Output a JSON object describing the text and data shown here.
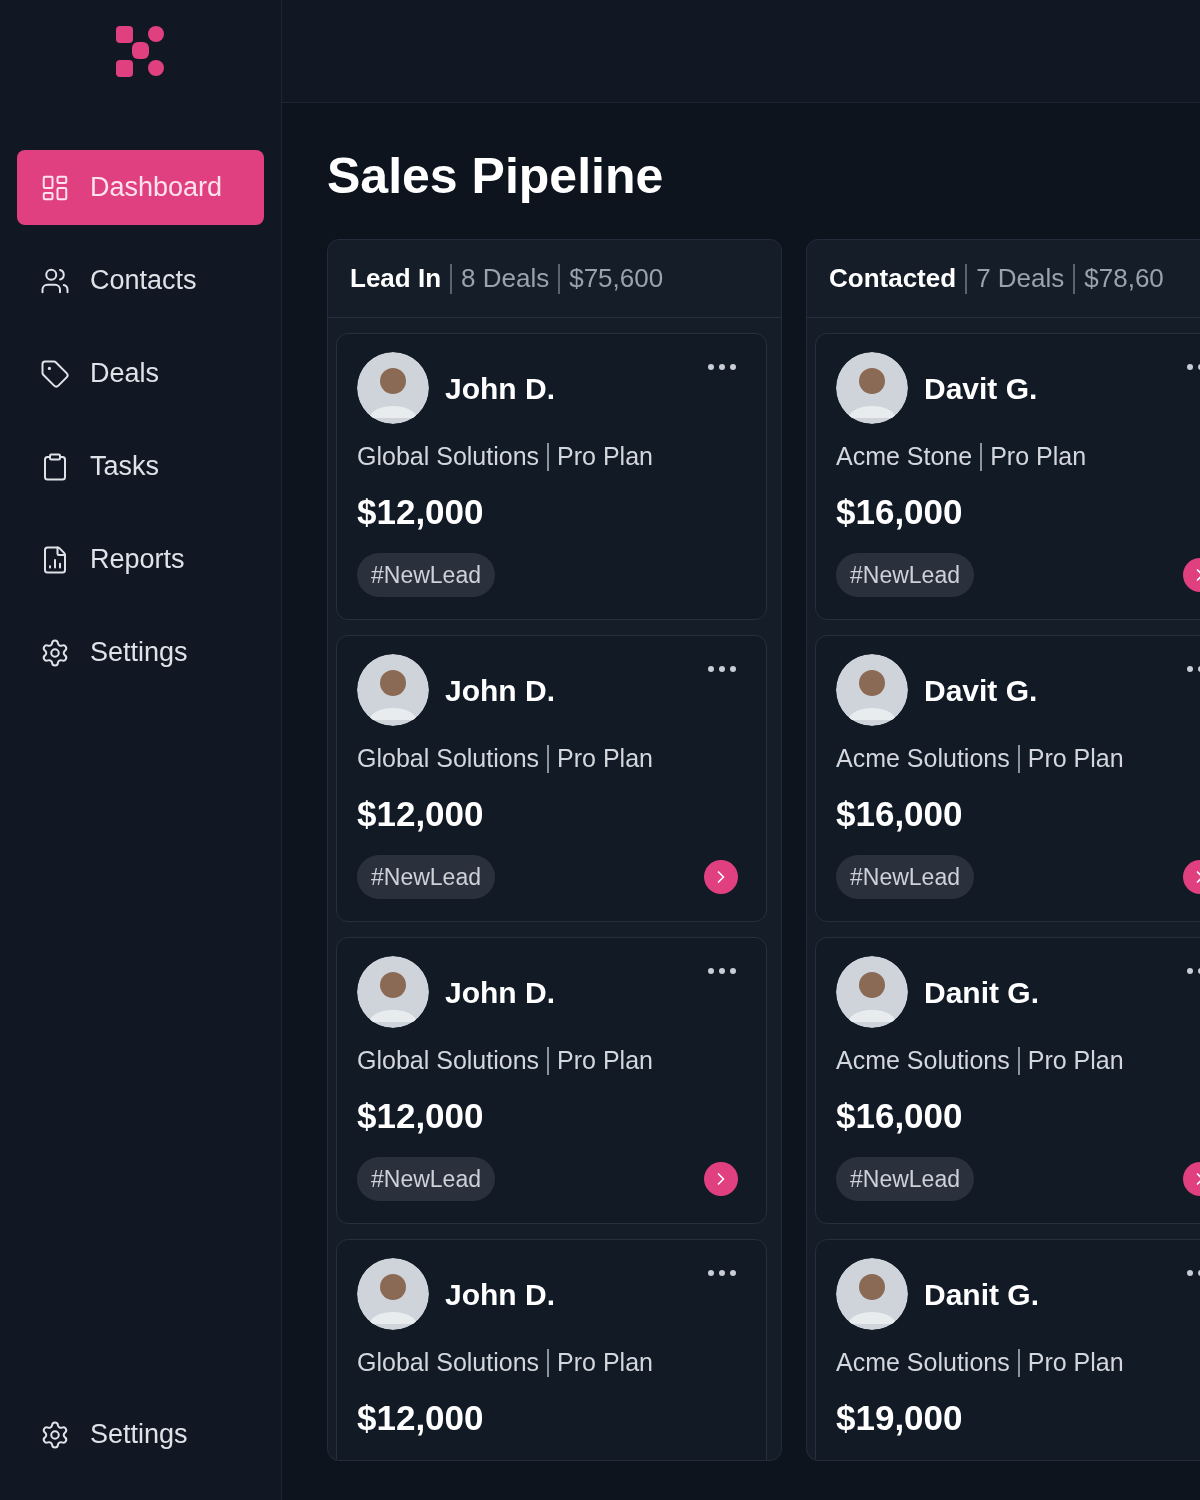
{
  "sidebar": {
    "items": [
      {
        "label": "Dashboard",
        "selected": true
      },
      {
        "label": "Contacts",
        "selected": false
      },
      {
        "label": "Deals",
        "selected": false
      },
      {
        "label": "Tasks",
        "selected": false
      },
      {
        "label": "Reports",
        "selected": false
      },
      {
        "label": "Settings",
        "selected": false
      }
    ],
    "footer_item": {
      "label": "Settings"
    }
  },
  "page_title": "Sales Pipeline",
  "columns": [
    {
      "title": "Lead In",
      "deals": "8 Deals",
      "total": "$75,600",
      "cards": [
        {
          "name": "John D.",
          "company": "Global Solutions",
          "plan": "Pro Plan",
          "amount": "$12,000",
          "tag": "#NewLead",
          "advance": false
        },
        {
          "name": "John D.",
          "company": "Global Solutions",
          "plan": "Pro Plan",
          "amount": "$12,000",
          "tag": "#NewLead",
          "advance": true
        },
        {
          "name": "John D.",
          "company": "Global Solutions",
          "plan": "Pro Plan",
          "amount": "$12,000",
          "tag": "#NewLead",
          "advance": true
        },
        {
          "name": "John D.",
          "company": "Global Solutions",
          "plan": "Pro Plan",
          "amount": "$12,000"
        }
      ]
    },
    {
      "title": "Contacted",
      "deals": "7 Deals",
      "total": "$78,60",
      "cards": [
        {
          "name": "Davit G.",
          "company": "Acme Stone",
          "plan": "Pro Plan",
          "amount": "$16,000",
          "tag": "#NewLead",
          "advance": true
        },
        {
          "name": "Davit G.",
          "company": "Acme Solutions",
          "plan": "Pro Plan",
          "amount": "$16,000",
          "tag": "#NewLead",
          "advance": true
        },
        {
          "name": "Danit G.",
          "company": "Acme Solutions",
          "plan": "Pro Plan",
          "amount": "$16,000",
          "tag": "#NewLead",
          "advance": true
        },
        {
          "name": "Danit G.",
          "company": "Acme Solutions",
          "plan": "Pro Plan",
          "amount": "$19,000"
        }
      ]
    }
  ]
}
